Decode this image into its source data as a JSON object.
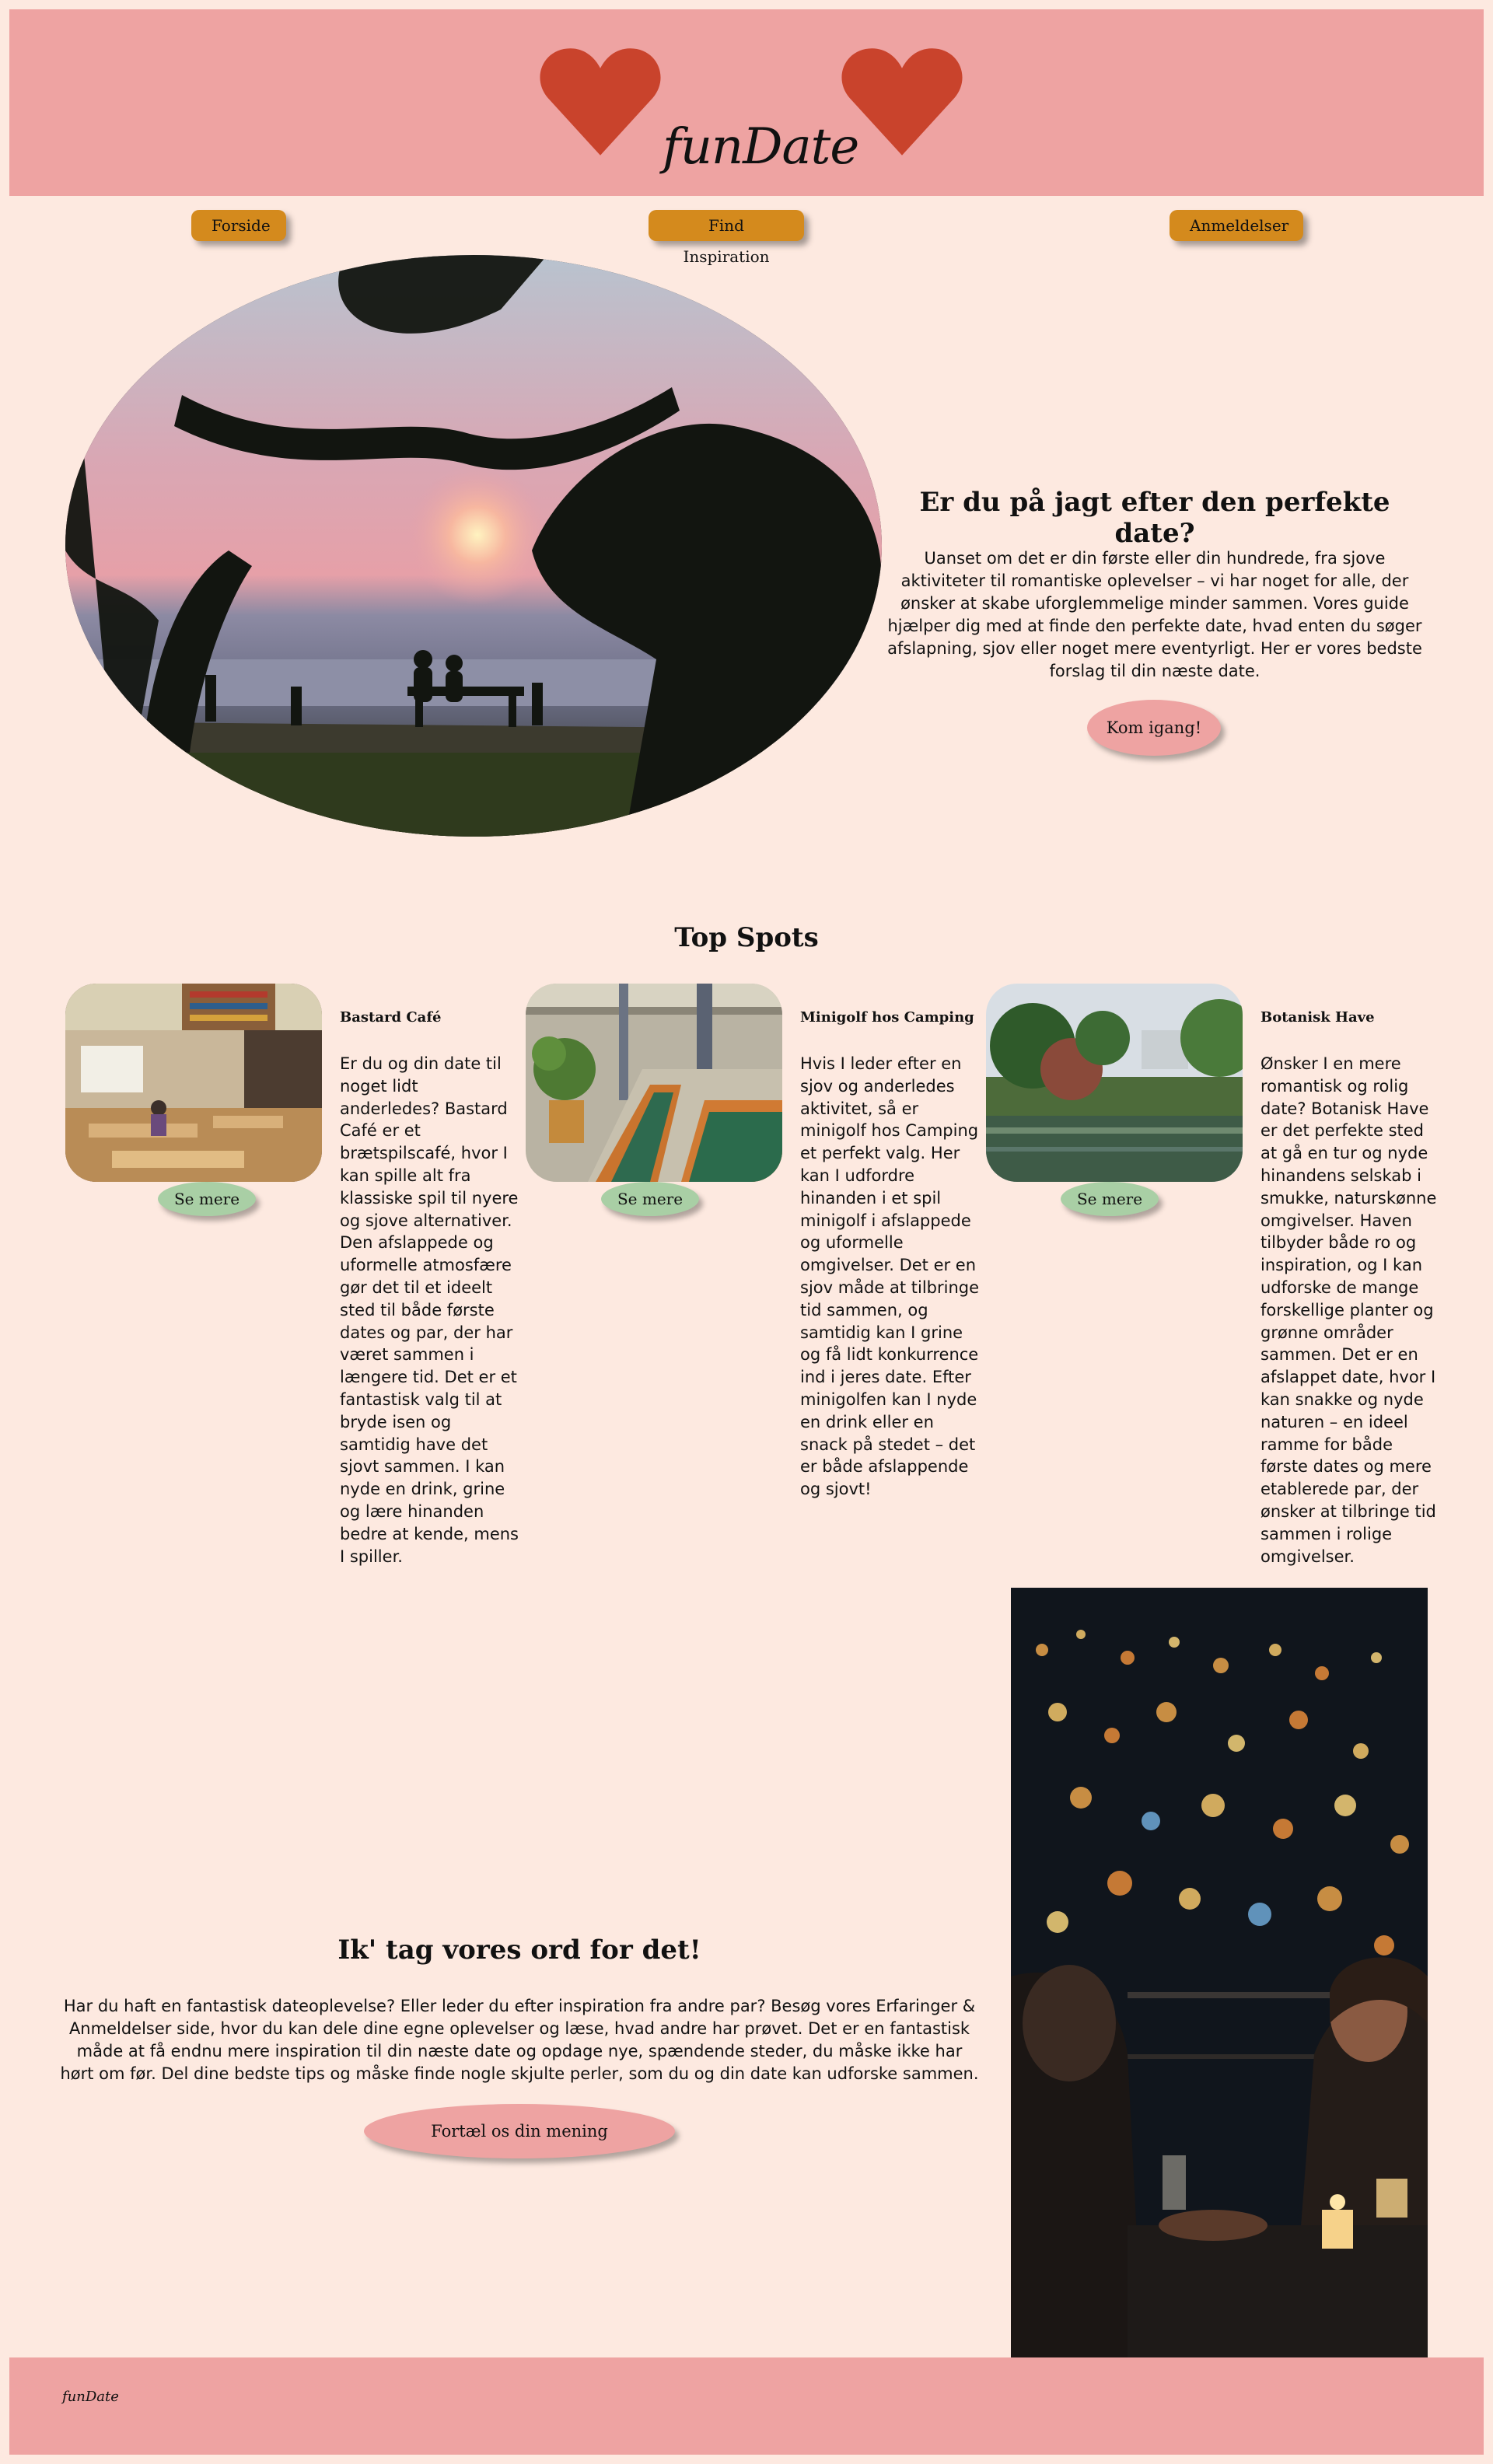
{
  "header": {
    "logo_text": "funDate",
    "heart_color": "#c9432c",
    "background": "#eea3a2"
  },
  "nav": {
    "items": [
      {
        "label": "Forside"
      },
      {
        "label": "Find Inspiration"
      },
      {
        "label": "Anmeldelser"
      }
    ],
    "button_color": "#d48a1d"
  },
  "hero": {
    "title": "Er du på jagt efter den perfekte date?",
    "text": "Uanset om det er din første eller din hundrede, fra sjove aktiviteter til romantiske oplevelser – vi har noget for alle, der ønsker at skabe uforglemmelige minder sammen. Vores guide hjælper dig med at finde den perfekte date, hvad enten du søger afslapning, sjov eller noget mere eventyrligt. Her er vores bedste forslag til din næste date.",
    "cta_label": "Kom igang!"
  },
  "top_spots": {
    "title": "Top Spots",
    "more_label": "Se mere",
    "items": [
      {
        "name": "Bastard Café",
        "text": "Er du og din date til noget lidt anderledes? Bastard Café er et brætspilscafé, hvor I kan spille alt fra klassiske spil til nyere og sjove alternativer. Den afslappede og uformelle atmosfære gør det til et ideelt sted til både første dates og par, der har været sammen i længere tid. Det er et fantastisk valg til at bryde isen og samtidig have det sjovt sammen. I kan nyde en drink, grine og lære hinanden bedre at kende, mens I spiller."
      },
      {
        "name": "Minigolf hos Camping",
        "text": "Hvis I leder efter en sjov og anderledes aktivitet, så er minigolf hos Camping et perfekt valg. Her kan I udfordre hinanden i et spil minigolf i afslappede og uformelle omgivelser. Det er en sjov måde at tilbringe tid sammen, og samtidig kan I grine og få lidt konkurrence ind i jeres date. Efter minigolfen kan I nyde en drink eller en snack på stedet – det er både afslappende og sjovt!"
      },
      {
        "name": "Botanisk Have",
        "text": "Ønsker I en mere romantisk og rolig date? Botanisk Have er det perfekte sted at gå en tur og nyde hinandens selskab i smukke, naturskønne omgivelser. Haven tilbyder både ro og inspiration, og I kan udforske de mange forskellige planter og grønne områder sammen. Det er en afslappet date, hvor I kan snakke og nyde naturen – en ideel ramme for både første dates og mere etablerede par, der ønsker at tilbringe tid sammen i rolige omgivelser."
      }
    ],
    "more_button_color": "#a9cfa5"
  },
  "reviews": {
    "title": "Ik' tag vores ord for det!",
    "text": "Har du haft en fantastisk dateoplevelse? Eller leder du efter inspiration fra andre par? Besøg vores Erfaringer & Anmeldelser side, hvor du kan dele dine egne oplevelser og læse, hvad andre har prøvet. Det er en fantastisk måde at få endnu mere inspiration til din næste date og opdage nye, spændende steder, du måske ikke har hørt om før. Del dine bedste tips og måske finde nogle skjulte perler, som du og din date kan udforske sammen.",
    "cta_label": "Fortæl os din mening"
  },
  "footer": {
    "logo_text": "funDate"
  }
}
